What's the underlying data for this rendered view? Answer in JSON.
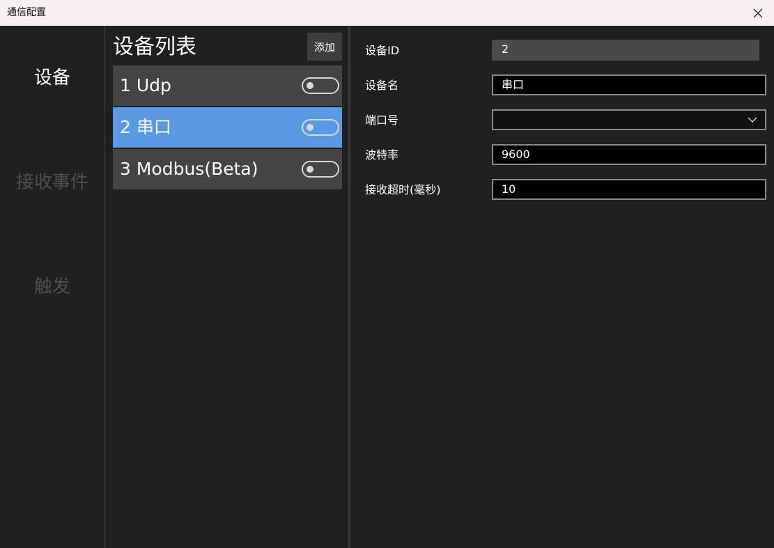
{
  "window": {
    "title": "通信配置"
  },
  "nav": {
    "items": [
      {
        "label": "设备",
        "active": true
      },
      {
        "label": "接收事件",
        "active": false
      },
      {
        "label": "触发",
        "active": false
      }
    ]
  },
  "device_list": {
    "title": "设备列表",
    "add_label": "添加",
    "devices": [
      {
        "label": "1 Udp",
        "enabled": false,
        "selected": false
      },
      {
        "label": "2 串口",
        "enabled": false,
        "selected": true
      },
      {
        "label": "3 Modbus(Beta)",
        "enabled": false,
        "selected": false
      }
    ]
  },
  "properties": {
    "device_id": {
      "label": "设备ID",
      "value": "2"
    },
    "device_name": {
      "label": "设备名",
      "value": "串口"
    },
    "port": {
      "label": "端口号",
      "value": ""
    },
    "baud_rate": {
      "label": "波特率",
      "value": "9600"
    },
    "timeout": {
      "label": "接收超时(毫秒)",
      "value": "10"
    }
  },
  "colors": {
    "accent": "#5a9ae4",
    "titlebar": "#f8f0ef",
    "background": "#202020"
  }
}
